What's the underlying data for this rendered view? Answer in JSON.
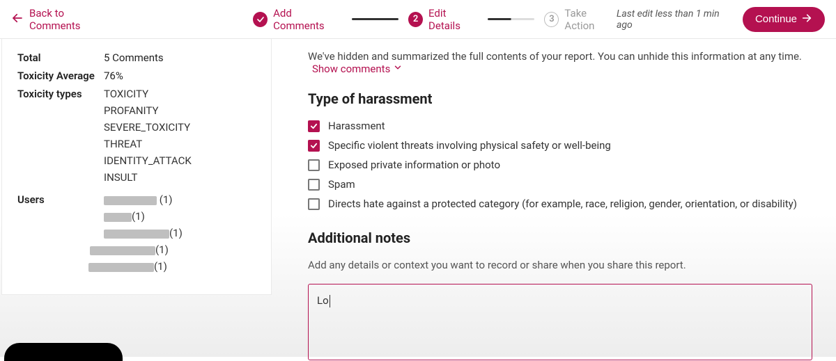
{
  "header": {
    "back_label": "Back to Comments",
    "steps": [
      {
        "label": "Add Comments",
        "badge": "check",
        "state": "done"
      },
      {
        "label": "Edit Details",
        "badge": "2",
        "state": "active"
      },
      {
        "label": "Take Action",
        "badge": "3",
        "state": "inactive"
      }
    ],
    "last_edit": "Last edit less than 1 min ago",
    "continue_label": "Continue"
  },
  "sidebar": {
    "total_label": "Total",
    "total_value": "5 Comments",
    "avg_label": "Toxicity Average",
    "avg_value": "76%",
    "types_label": "Toxicity types",
    "types": [
      "TOXICITY",
      "PROFANITY",
      "SEVERE_TOXICITY",
      "THREAT",
      "IDENTITY_ATTACK",
      "INSULT"
    ],
    "users_label": "Users",
    "users": [
      {
        "count": "(1)"
      },
      {
        "count": "(1)"
      },
      {
        "count": "(1)"
      },
      {
        "count": "(1)"
      },
      {
        "count": "(1)"
      }
    ]
  },
  "main": {
    "hide_note": "We've hidden and summarized the full contents of your report. You can unhide this information at any time.",
    "show_comments": "Show comments",
    "type_heading": "Type of harassment",
    "checks": [
      {
        "label": "Harassment",
        "checked": true
      },
      {
        "label": "Specific violent threats involving physical safety or well-being",
        "checked": true
      },
      {
        "label": "Exposed private information or photo",
        "checked": false
      },
      {
        "label": "Spam",
        "checked": false
      },
      {
        "label": "Directs hate against a protected category (for example, race, religion, gender, orientation, or disability)",
        "checked": false
      }
    ],
    "notes_heading": "Additional notes",
    "notes_desc": "Add any details or context you want to record or share when you share this report.",
    "notes_value": "Lo"
  },
  "colors": {
    "accent": "#b41150"
  }
}
